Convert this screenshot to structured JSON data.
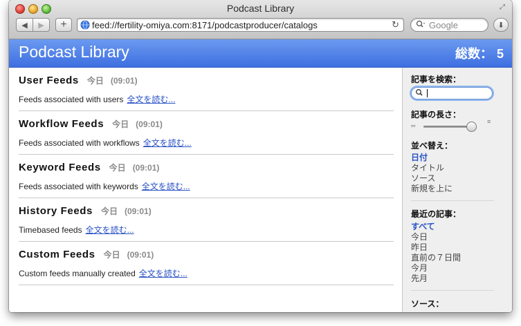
{
  "window": {
    "title": "Podcast Library"
  },
  "toolbar": {
    "back_glyph": "◀",
    "forward_glyph": "▶",
    "add_glyph": "+",
    "url": "feed://fertility-omiya.com:8171/podcastproducer/catalogs",
    "reload_glyph": "↻",
    "search_placeholder": "Google",
    "download_glyph": "⬇"
  },
  "header": {
    "title": "Podcast Library",
    "total_label": "総数：",
    "total_value": "5"
  },
  "feeds": [
    {
      "title": "User Feeds",
      "date": "今日",
      "time": "(09:01)",
      "description": "Feeds associated with users",
      "link": "全文を読む..."
    },
    {
      "title": "Workflow Feeds",
      "date": "今日",
      "time": "(09:01)",
      "description": "Feeds associated with workflows",
      "link": "全文を読む..."
    },
    {
      "title": "Keyword Feeds",
      "date": "今日",
      "time": "(09:01)",
      "description": "Feeds associated with keywords",
      "link": "全文を読む..."
    },
    {
      "title": "History Feeds",
      "date": "今日",
      "time": "(09:01)",
      "description": "Timebased feeds",
      "link": "全文を読む..."
    },
    {
      "title": "Custom Feeds",
      "date": "今日",
      "time": "(09:01)",
      "description": "Custom feeds manually created",
      "link": "全文を読む..."
    }
  ],
  "sidebar": {
    "search_label": "記事を検索：",
    "length_label": "記事の長さ：",
    "length_level": 0.9,
    "sort_label": "並べ替え：",
    "sort_options": [
      "日付",
      "タイトル",
      "ソース",
      "新規を上に"
    ],
    "sort_active": "日付",
    "recent_label": "最近の記事：",
    "recent_options": [
      "すべて",
      "今日",
      "昨日",
      "直前の７日間",
      "今月",
      "先月"
    ],
    "recent_active": "すべて",
    "source_label": "ソース："
  },
  "colors": {
    "header_blue": "#4a7ce6",
    "link_blue": "#2a52c6"
  }
}
